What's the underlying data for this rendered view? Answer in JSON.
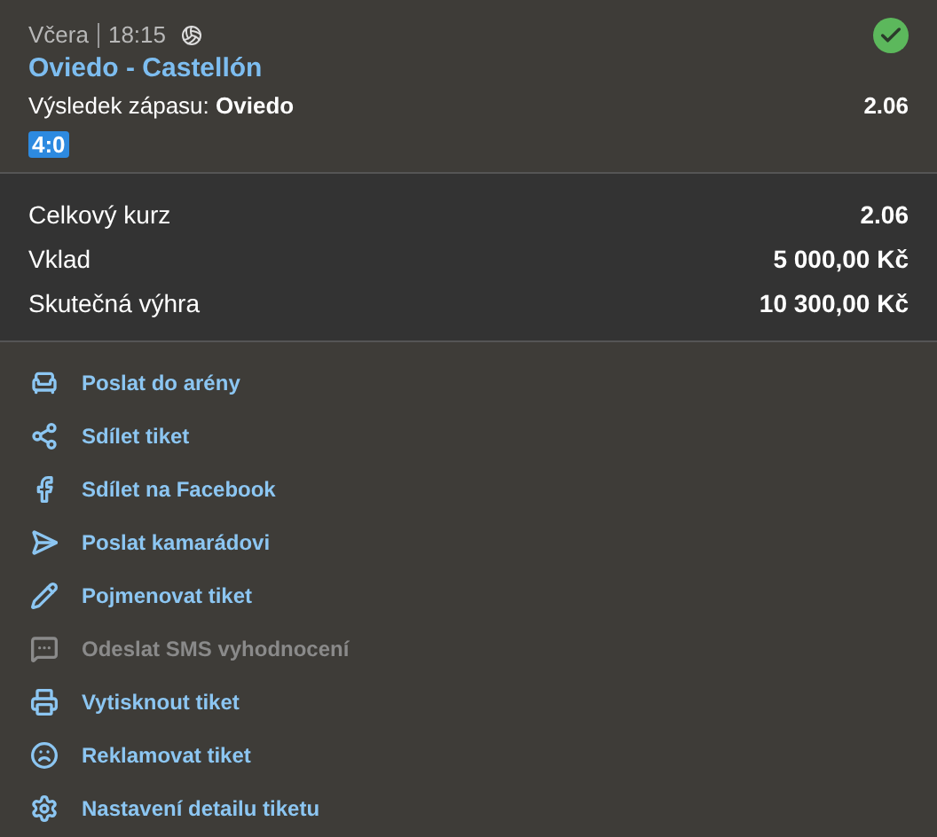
{
  "bet": {
    "day": "Včera",
    "time": "18:15",
    "won": true,
    "match": "Oviedo - Castellón",
    "market": "Výsledek zápasu: ",
    "pick": "Oviedo",
    "odds": "2.06",
    "score": "4:0"
  },
  "summary": [
    {
      "label": "Celkový kurz",
      "value": "2.06"
    },
    {
      "label": "Vklad",
      "value": "5 000,00 Kč"
    },
    {
      "label": "Skutečná výhra",
      "value": "10 300,00 Kč"
    }
  ],
  "actions": [
    {
      "kind": "arena",
      "label": "Poslat do arény",
      "disabled": false
    },
    {
      "kind": "share",
      "label": "Sdílet tiket",
      "disabled": false
    },
    {
      "kind": "facebook",
      "label": "Sdílet na Facebook",
      "disabled": false
    },
    {
      "kind": "send",
      "label": "Poslat kamarádovi",
      "disabled": false
    },
    {
      "kind": "rename",
      "label": "Pojmenovat tiket",
      "disabled": false
    },
    {
      "kind": "sms",
      "label": "Odeslat SMS vyhodnocení",
      "disabled": true
    },
    {
      "kind": "print",
      "label": "Vytisknout tiket",
      "disabled": false
    },
    {
      "kind": "complain",
      "label": "Reklamovat tiket",
      "disabled": false
    },
    {
      "kind": "settings",
      "label": "Nastavení detailu tiketu",
      "disabled": false
    }
  ]
}
